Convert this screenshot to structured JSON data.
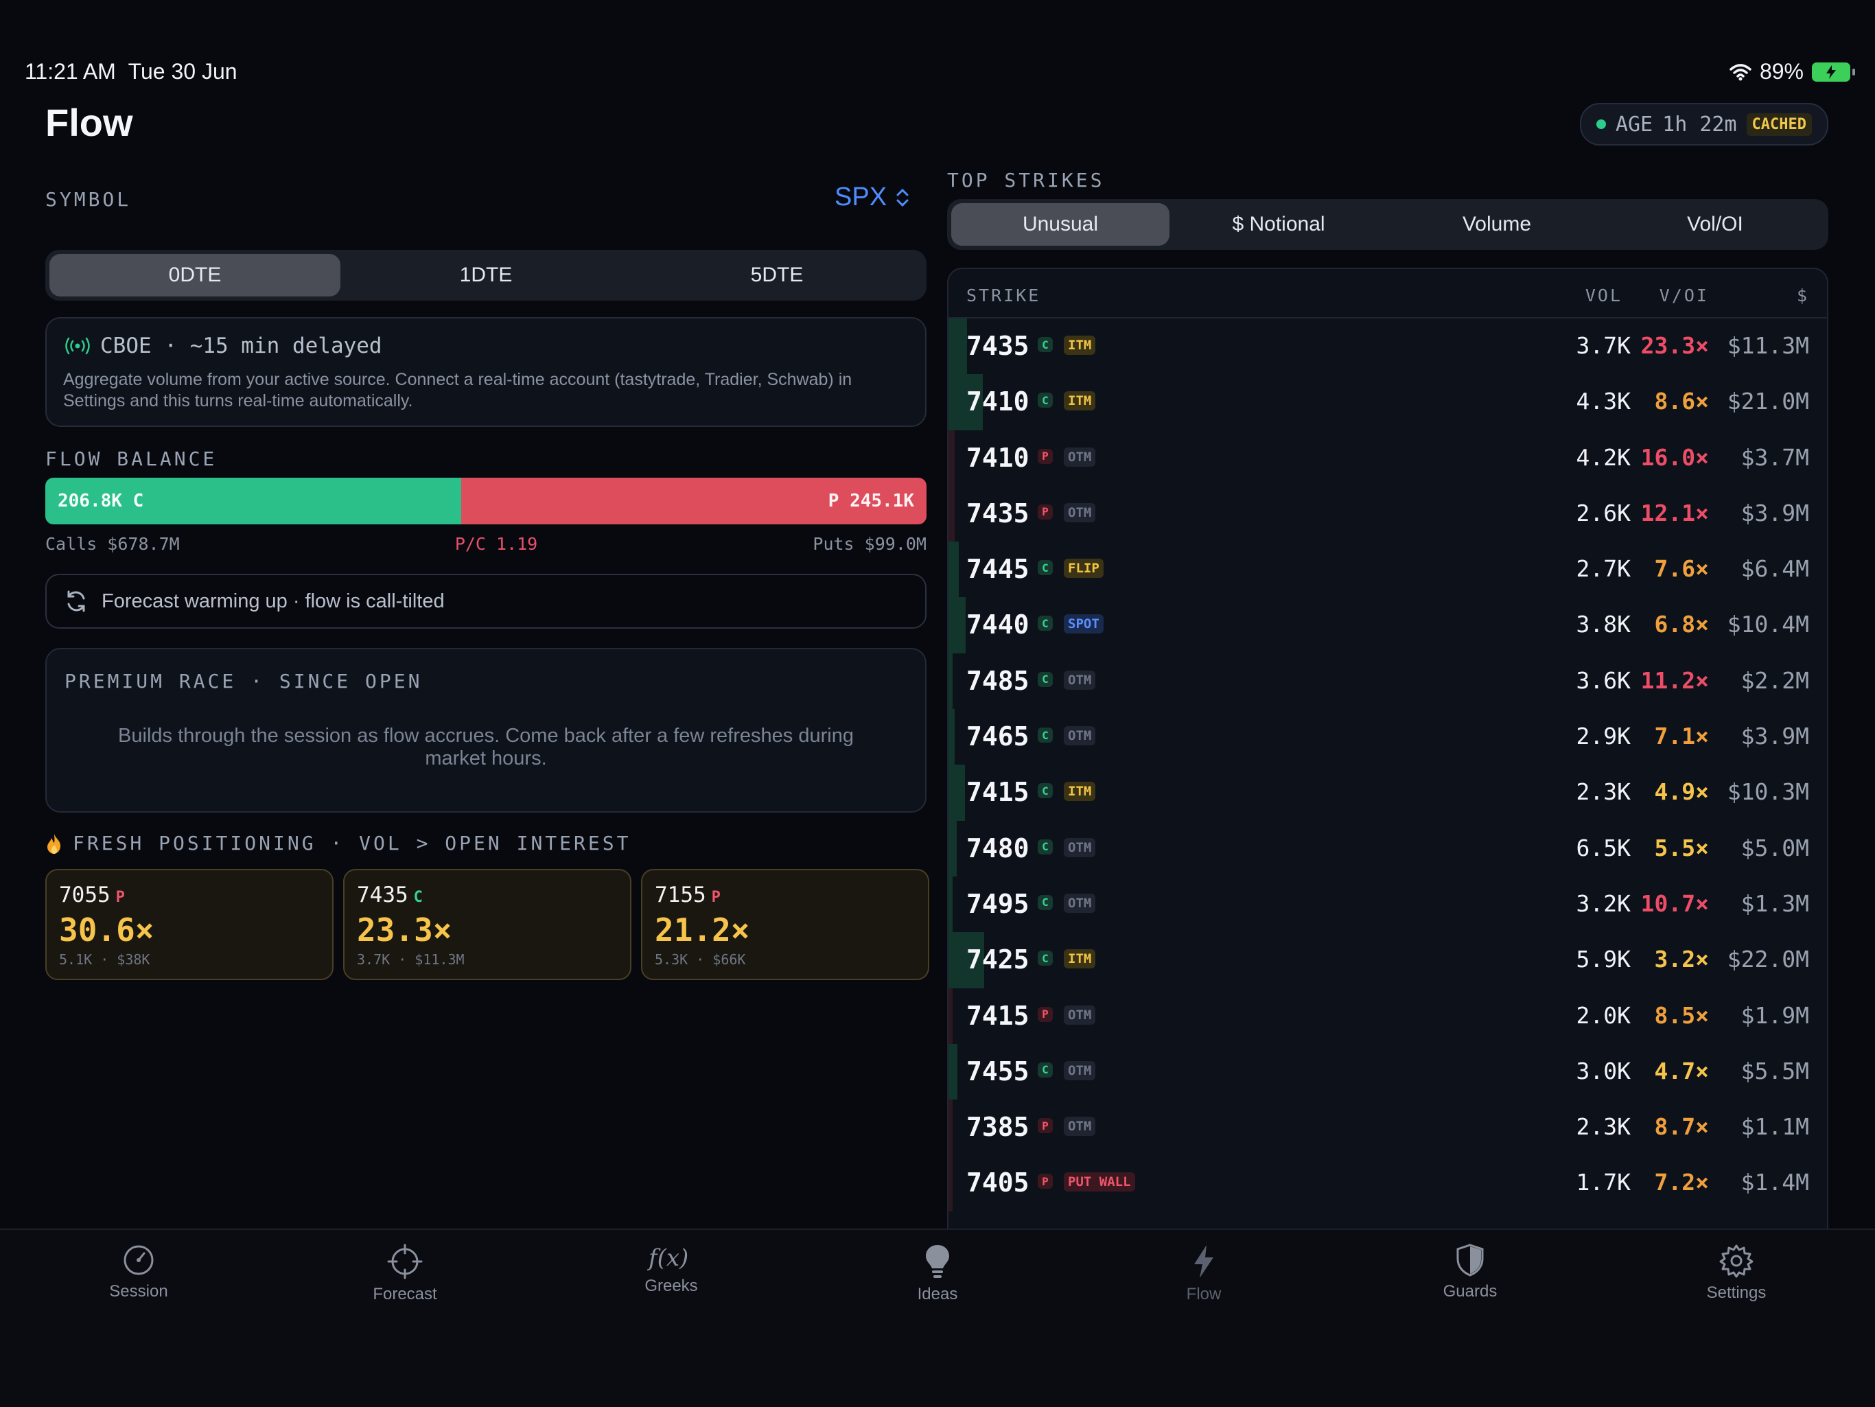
{
  "status": {
    "time": "11:21 AM",
    "date": "Tue 30 Jun",
    "battery": "89%"
  },
  "header": {
    "title": "Flow",
    "age_label": "AGE",
    "age_value": "1h 22m",
    "cached": "CACHED"
  },
  "symbol": {
    "label": "SYMBOL",
    "value": "SPX"
  },
  "dte_tabs": [
    "0DTE",
    "1DTE",
    "5DTE"
  ],
  "dte_active": "0DTE",
  "source": {
    "title": "CBOE · ~15 min delayed",
    "body": "Aggregate volume from your active source. Connect a real-time account (tastytrade, Tradier, Schwab) in Settings and this turns real-time automatically."
  },
  "flow_balance": {
    "label": "FLOW BALANCE",
    "calls": "206.8K C",
    "puts": "P 245.1K",
    "call_fraction": 0.458,
    "calls_notional": "Calls $678.7M",
    "pc_ratio": "P/C 1.19",
    "puts_notional": "Puts $99.0M"
  },
  "forecast": {
    "text": "Forecast warming up · flow is call-tilted"
  },
  "premium_race": {
    "title": "PREMIUM RACE · SINCE OPEN",
    "body": "Builds through the session as flow accrues. Come back after a few refreshes during market hours."
  },
  "fresh": {
    "label": "FRESH POSITIONING · VOL > OPEN INTEREST",
    "cards": [
      {
        "strike": "7055",
        "type": "P",
        "ratio": "30.6×",
        "sub": "5.1K · $38K"
      },
      {
        "strike": "7435",
        "type": "C",
        "ratio": "23.3×",
        "sub": "3.7K · $11.3M"
      },
      {
        "strike": "7155",
        "type": "P",
        "ratio": "21.2×",
        "sub": "5.3K · $66K"
      }
    ]
  },
  "top_strikes": {
    "label": "TOP STRIKES",
    "tabs": [
      "Unusual",
      "$ Notional",
      "Volume",
      "Vol/OI"
    ],
    "active_tab": "Unusual",
    "columns": {
      "strike": "STRIKE",
      "vol": "VOL",
      "voi": "V/OI",
      "notional": "$"
    },
    "rows": [
      {
        "strike": "7435",
        "type": "C",
        "tag": "ITM",
        "vol": "3.7K",
        "voi": "23.3×",
        "notional": "$11.3M"
      },
      {
        "strike": "7410",
        "type": "C",
        "tag": "ITM",
        "vol": "4.3K",
        "voi": "8.6×",
        "notional": "$21.0M"
      },
      {
        "strike": "7410",
        "type": "P",
        "tag": "OTM",
        "vol": "4.2K",
        "voi": "16.0×",
        "notional": "$3.7M"
      },
      {
        "strike": "7435",
        "type": "P",
        "tag": "OTM",
        "vol": "2.6K",
        "voi": "12.1×",
        "notional": "$3.9M"
      },
      {
        "strike": "7445",
        "type": "C",
        "tag": "FLIP",
        "vol": "2.7K",
        "voi": "7.6×",
        "notional": "$6.4M"
      },
      {
        "strike": "7440",
        "type": "C",
        "tag": "SPOT",
        "vol": "3.8K",
        "voi": "6.8×",
        "notional": "$10.4M"
      },
      {
        "strike": "7485",
        "type": "C",
        "tag": "OTM",
        "vol": "3.6K",
        "voi": "11.2×",
        "notional": "$2.2M"
      },
      {
        "strike": "7465",
        "type": "C",
        "tag": "OTM",
        "vol": "2.9K",
        "voi": "7.1×",
        "notional": "$3.9M"
      },
      {
        "strike": "7415",
        "type": "C",
        "tag": "ITM",
        "vol": "2.3K",
        "voi": "4.9×",
        "notional": "$10.3M"
      },
      {
        "strike": "7480",
        "type": "C",
        "tag": "OTM",
        "vol": "6.5K",
        "voi": "5.5×",
        "notional": "$5.0M"
      },
      {
        "strike": "7495",
        "type": "C",
        "tag": "OTM",
        "vol": "3.2K",
        "voi": "10.7×",
        "notional": "$1.3M"
      },
      {
        "strike": "7425",
        "type": "C",
        "tag": "ITM",
        "vol": "5.9K",
        "voi": "3.2×",
        "notional": "$22.0M"
      },
      {
        "strike": "7415",
        "type": "P",
        "tag": "OTM",
        "vol": "2.0K",
        "voi": "8.5×",
        "notional": "$1.9M"
      },
      {
        "strike": "7455",
        "type": "C",
        "tag": "OTM",
        "vol": "3.0K",
        "voi": "4.7×",
        "notional": "$5.5M"
      },
      {
        "strike": "7385",
        "type": "P",
        "tag": "OTM",
        "vol": "2.3K",
        "voi": "8.7×",
        "notional": "$1.1M"
      },
      {
        "strike": "7405",
        "type": "P",
        "tag": "PUT WALL",
        "vol": "1.7K",
        "voi": "7.2×",
        "notional": "$1.4M"
      }
    ]
  },
  "nav": [
    {
      "label": "Session",
      "icon": "gauge-icon"
    },
    {
      "label": "Forecast",
      "icon": "crosshair-icon"
    },
    {
      "label": "Greeks",
      "icon": "function-icon"
    },
    {
      "label": "Ideas",
      "icon": "lightbulb-icon"
    },
    {
      "label": "Flow",
      "icon": "bolt-icon"
    },
    {
      "label": "Guards",
      "icon": "shield-icon"
    },
    {
      "label": "Settings",
      "icon": "gear-icon"
    }
  ],
  "colors": {
    "accent": "#4f8cff",
    "call": "#2bbf8a",
    "put": "#dd4d5c",
    "ratio_high": "#ee4d67",
    "ratio_mid": "#f0a03c",
    "ratio_low": "#f6c44a"
  }
}
